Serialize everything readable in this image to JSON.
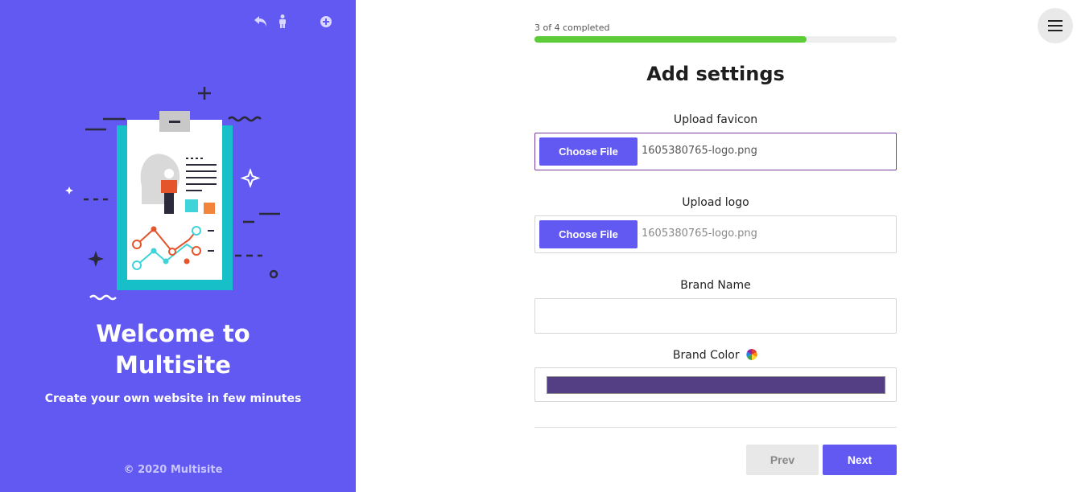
{
  "sidebar": {
    "welcome_line1": "Welcome to",
    "welcome_line2": "Multisite",
    "tagline": "Create your own website in few minutes",
    "copyright": "© 2020 Multisite",
    "icons": [
      "undo-icon",
      "accessibility-icon",
      "plus-circle-icon"
    ],
    "background_color": "#6159f2"
  },
  "progress": {
    "text": "3 of 4 completed",
    "completed": 3,
    "total": 4,
    "color": "#5ccd37"
  },
  "form": {
    "title": "Add settings",
    "favicon": {
      "label": "Upload favicon",
      "button": "Choose File",
      "filename": "1605380765-logo.png"
    },
    "logo": {
      "label": "Upload logo",
      "button": "Choose File",
      "filename": "1605380765-logo.png"
    },
    "brand_name": {
      "label": "Brand Name",
      "value": ""
    },
    "brand_color": {
      "label": "Brand Color",
      "value": "#553f84"
    },
    "prev_label": "Prev",
    "next_label": "Next"
  },
  "menu": {
    "icon": "hamburger-icon"
  }
}
